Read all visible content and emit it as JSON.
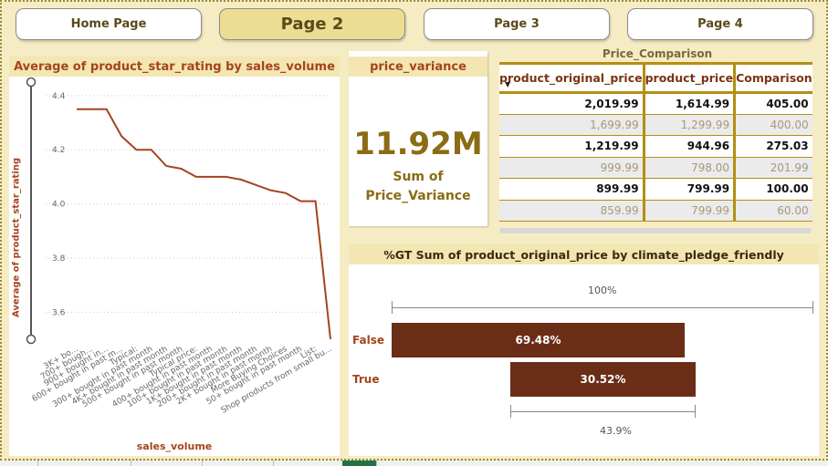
{
  "nav": {
    "home_label": "Home Page",
    "page2_label": "Page 2",
    "page3_label": "Page 3",
    "page4_label": "Page 4"
  },
  "line_chart": {
    "title": "Average of product_star_rating by sales_volume",
    "xlabel": "sales_volume",
    "ylabel": "Average of product_star_rating"
  },
  "kpi": {
    "title": "price_variance",
    "value": "11.92M",
    "label_line1": "Sum of",
    "label_line2": "Price_Variance"
  },
  "table": {
    "title": "Price_Comparison",
    "headers": [
      "product_original_price",
      "product_price",
      "Comparison"
    ],
    "rows": [
      [
        "2,019.99",
        "1,614.99",
        "405.00"
      ],
      [
        "1,699.99",
        "1,299.99",
        "400.00"
      ],
      [
        "1,219.99",
        "944.96",
        "275.03"
      ],
      [
        "999.99",
        "798.00",
        "201.99"
      ],
      [
        "899.99",
        "799.99",
        "100.00"
      ],
      [
        "859.99",
        "799.99",
        "60.00"
      ]
    ]
  },
  "bar_chart": {
    "title": "%GT Sum of product_original_price by climate_pledge_friendly",
    "top_scale_label": "100%",
    "bottom_scale_label": "43.9%",
    "categories": [
      {
        "label": "False",
        "value_label": "69.48%"
      },
      {
        "label": "True",
        "value_label": "30.52%"
      }
    ]
  },
  "colors": {
    "line": "#a4441e",
    "bar": "#6a2e17",
    "gold": "#b38f12",
    "background": "#f6ecc4"
  },
  "chart_data": [
    {
      "type": "line",
      "title": "Average of product_star_rating by sales_volume",
      "xlabel": "sales_volume",
      "ylabel": "Average of product_star_rating",
      "categories": [
        "3K+ bo...",
        "700+ bough...",
        "900+ bought in...",
        "600+ bought in past m...",
        "Typical:",
        "300+ bought in past month",
        "4K+ bought in past month",
        "500+ bought in past month",
        "Typical price:",
        "400+ bought in past month",
        "100+ bought in past month",
        "1K+ bought in past month",
        "200+ bought in past month",
        "2K+ bought in past month",
        "More Buying Choices",
        "50+ bought in past month",
        "List:",
        "Shop products from small bu..."
      ],
      "values": [
        4.35,
        4.35,
        4.35,
        4.25,
        4.2,
        4.2,
        4.14,
        4.13,
        4.1,
        4.1,
        4.1,
        4.09,
        4.07,
        4.05,
        4.04,
        4.01,
        4.01,
        3.5
      ],
      "yticks": [
        3.6,
        3.8,
        4.0,
        4.2,
        4.4
      ],
      "ylim": [
        3.5,
        4.45
      ],
      "grid": true
    },
    {
      "type": "bar",
      "title": "%GT Sum of product_original_price by climate_pledge_friendly",
      "categories": [
        "False",
        "True"
      ],
      "values": [
        69.48,
        30.52
      ],
      "unit": "%"
    }
  ]
}
